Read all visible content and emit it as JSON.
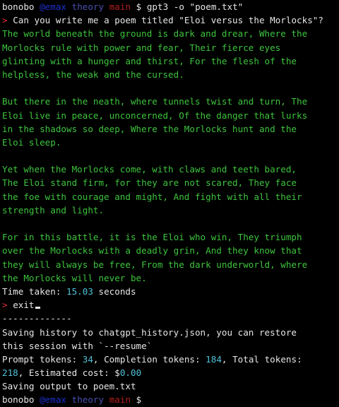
{
  "shell": {
    "user": "bonobo",
    "path": "@emax",
    "dir": "theory",
    "branch": "main",
    "symbol": "$",
    "command": "gpt3 -o \"poem.txt\""
  },
  "chat": {
    "marker": ">",
    "question": "Can you write me a poem titled \"Eloi versus the Morlocks\"?",
    "response_lines": [
      "The world beneath the ground is dark and drear, Where the",
      "Morlocks rule with power and fear, Their fierce eyes",
      "glinting with a hunger and thirst, For the flesh of the",
      "helpless, the weak and the cursed.",
      "",
      "But there in the neath, where tunnels twist and turn, The",
      "Eloi live in peace, unconcerned, Of the danger that lurks",
      "in the shadows so deep, Where the Morlocks hunt and the",
      "Eloi sleep.",
      "",
      "Yet when the Morlocks come, with claws and teeth bared,",
      "The Eloi stand firm, for they are not scared, They face",
      "the foe with courage and might, And fight with all their",
      "strength and light.",
      "",
      "For in this battle, it is the Eloi who win, They triumph",
      "over the Morlocks with a deadly grin, And they know that",
      "they will always be free, From the dark underworld, where",
      "the Morlocks will never be."
    ],
    "time_label": "Time taken:",
    "time_value": "15.03",
    "time_unit": "seconds",
    "exit_command": "exit"
  },
  "summary": {
    "separator": "-------------",
    "history_line1": "Saving history to chatgpt_history.json, you can restore",
    "history_line2": "this session with `--resume`",
    "prompt_tokens_label": "Prompt tokens:",
    "prompt_tokens": "34",
    "completion_tokens_label": ", Completion tokens:",
    "completion_tokens": "184",
    "total_tokens_label": ", Total tokens:",
    "total_tokens": "218",
    "cost_label": ", Estimated cost:",
    "cost_currency": "$",
    "cost_value": "0.00",
    "output_line": "Saving output to poem.txt"
  },
  "colors": {
    "background": "#000000",
    "text": "#e6e6e6",
    "poem": "#3ec43e",
    "number": "#4fc3d9",
    "marker": "#e0303a",
    "branch": "#b51d1d",
    "path": "#1d2fd1"
  }
}
